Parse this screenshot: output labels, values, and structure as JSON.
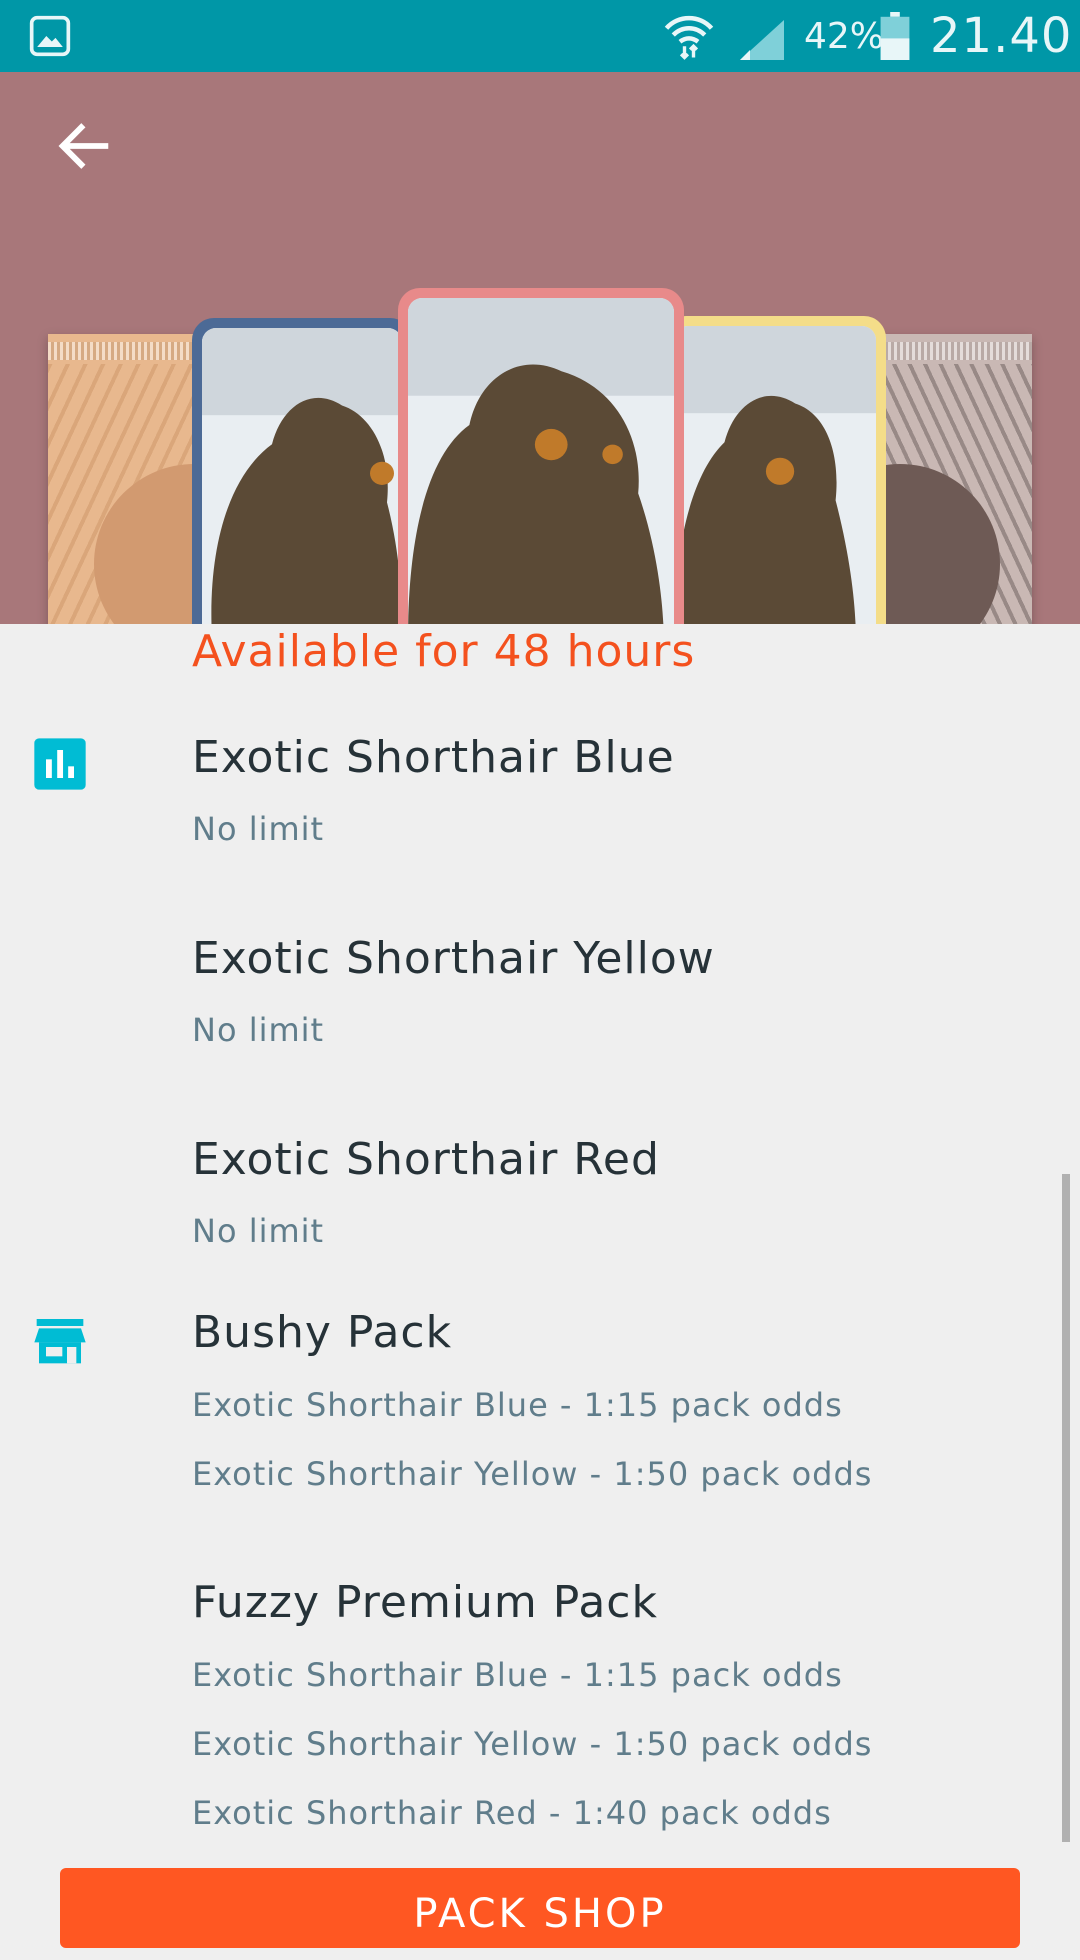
{
  "status_bar": {
    "battery_percent": "42%",
    "time": "21.40",
    "icons": [
      "gallery-icon",
      "wifi-icon",
      "signal-icon",
      "battery-icon"
    ]
  },
  "header": {
    "back_icon": "arrow-back-icon",
    "background_color": "#a8777a"
  },
  "availability": "Available for 48 hours",
  "cards_section": {
    "icon": "bar-chart-icon",
    "items": [
      {
        "title": "Exotic Shorthair Blue",
        "subtitle": "No limit"
      },
      {
        "title": "Exotic Shorthair Yellow",
        "subtitle": "No limit"
      },
      {
        "title": "Exotic Shorthair Red",
        "subtitle": "No limit"
      }
    ]
  },
  "packs_section": {
    "icon": "store-icon",
    "packs": [
      {
        "title": "Bushy Pack",
        "odds": [
          "Exotic Shorthair Blue - 1:15 pack odds",
          "Exotic Shorthair Yellow - 1:50 pack odds"
        ]
      },
      {
        "title": "Fuzzy Premium Pack",
        "odds": [
          "Exotic Shorthair Blue - 1:15 pack odds",
          "Exotic Shorthair Yellow - 1:50 pack odds",
          "Exotic Shorthair Red - 1:40 pack odds"
        ]
      }
    ]
  },
  "footer": {
    "button_label": "PACK SHOP"
  },
  "colors": {
    "status_bar": "#0097a7",
    "accent": "#ff5722",
    "availability_text": "#f4511e",
    "icon": "#00bcd4"
  }
}
